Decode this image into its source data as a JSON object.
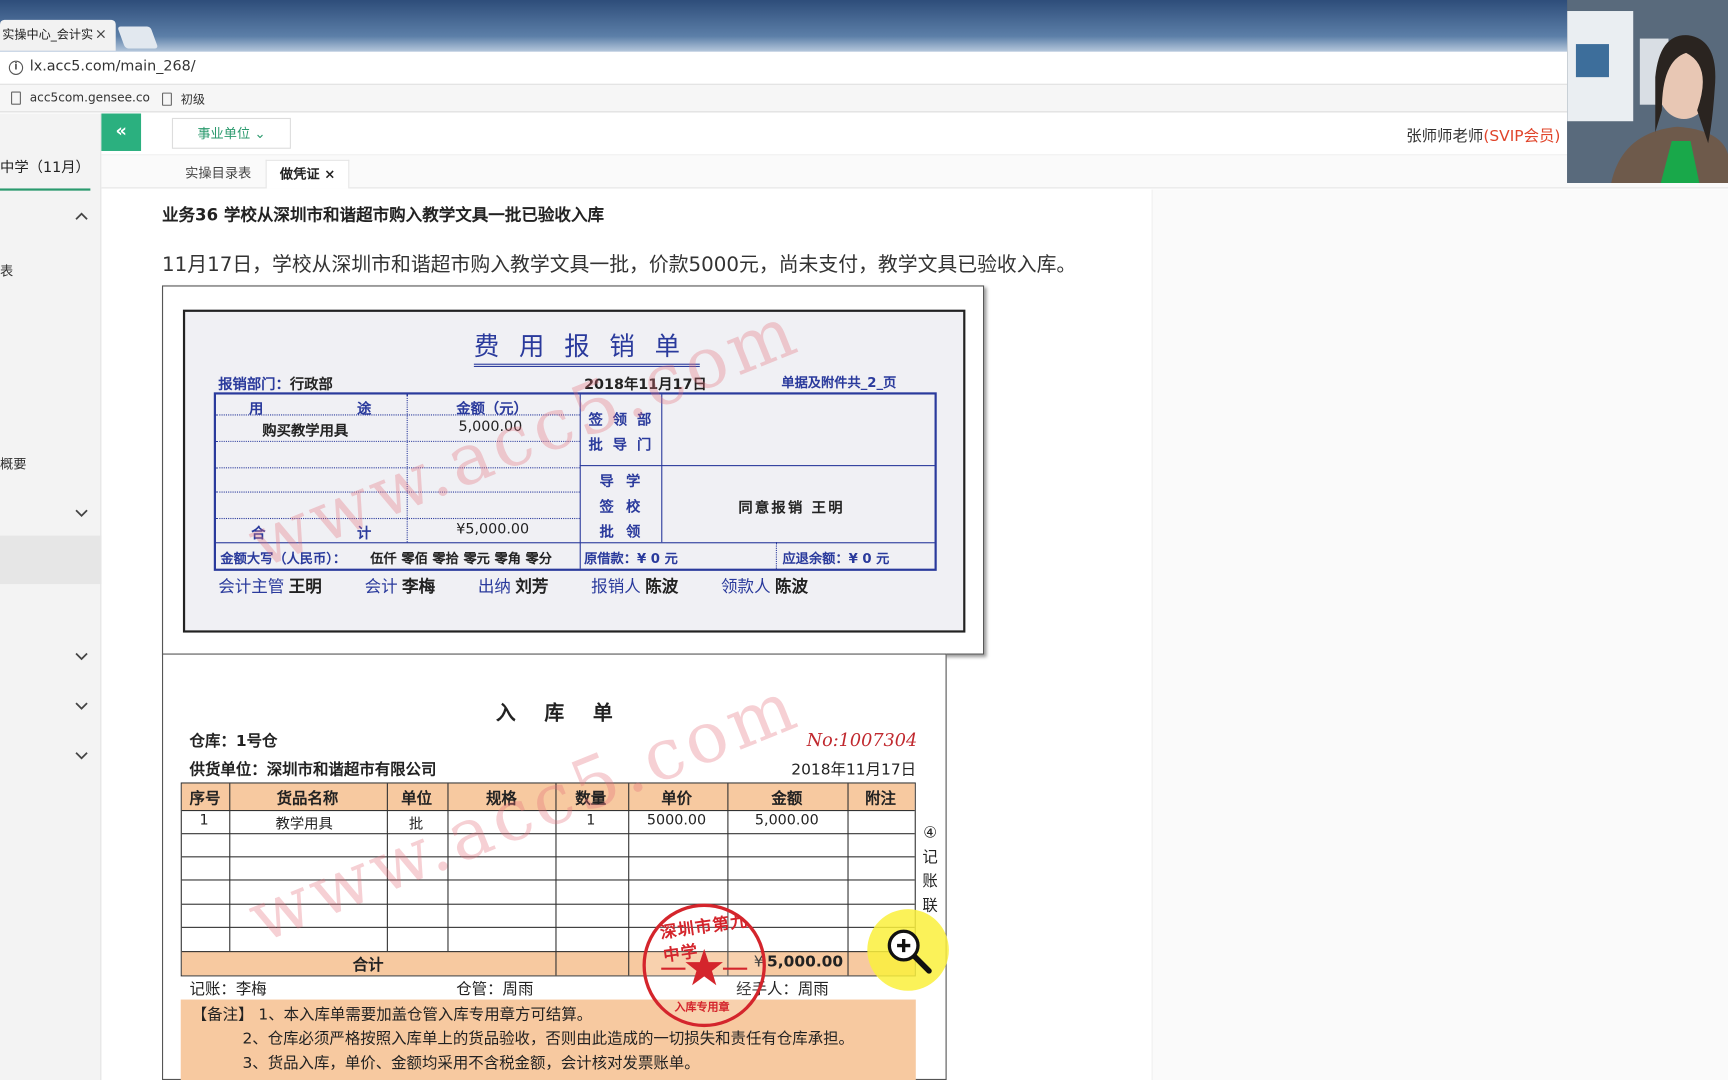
{
  "browser": {
    "tab_title": "实操中心_会计实",
    "url": "lx.acc5.com/main_268/",
    "bookmarks": [
      "acc5com.gensee.co",
      "初级"
    ]
  },
  "app": {
    "unit_select": "事业单位",
    "user_name": "张师师老师",
    "vip": "(SVIP会员)",
    "collapse_icon": "«",
    "sidebar": {
      "title": "中学（11月）",
      "items": [
        "表",
        "概要"
      ]
    },
    "subtabs": [
      "实操目录表",
      "做凭证"
    ],
    "close": "×"
  },
  "task": {
    "title": "业务36 学校从深圳市和谐超市购入教学文具一批已验收入库",
    "desc": "11月17日，学校从深圳市和谐超市购入教学文具一批，价款5000元，尚未支付，教学文具已验收入库。"
  },
  "reimburse": {
    "title": "费用报销单",
    "dept_label": "报销部门：",
    "dept": "行政部",
    "date": "2018年11月17日",
    "attach": "单据及附件共_2_页",
    "col_purpose": [
      "用",
      "途"
    ],
    "col_amount": "金额（元）",
    "item": "购买教学用具",
    "item_amount": "5,000.00",
    "total_label": [
      "合",
      "计"
    ],
    "total": "¥5,000.00",
    "dept_sign": [
      "签",
      "领",
      "部",
      "批",
      "导",
      "门"
    ],
    "school_sign": [
      "导",
      "学",
      "签",
      "校",
      "批",
      "领"
    ],
    "approval": "同意报销 王明",
    "daxie_label": "金额大写（人民币）：",
    "daxie": "伍仟 零佰 零拾 零元 零角 零分",
    "borrow": "原借款：¥  0   元",
    "refund": "应退余额：¥  0   元",
    "signers": [
      {
        "role": "会计主管",
        "name": "王明"
      },
      {
        "role": "会计",
        "name": "李梅"
      },
      {
        "role": "出纳",
        "name": "刘芳"
      },
      {
        "role": "报销人",
        "name": "陈波"
      },
      {
        "role": "领款人",
        "name": "陈波"
      }
    ]
  },
  "receipt": {
    "title": "入库单",
    "warehouse": "仓库：1号仓",
    "no": "No:1007304",
    "supplier": "供货单位：深圳市和谐超市有限公司",
    "date": "2018年11月17日",
    "headers": [
      "序号",
      "货品名称",
      "单位",
      "规格",
      "数量",
      "单价",
      "金额",
      "附注"
    ],
    "row": [
      "1",
      "教学用具",
      "批",
      "",
      "1",
      "5000.00",
      "5,000.00",
      ""
    ],
    "total_label": "合计",
    "total": "5,000.00",
    "total_prefix": "¥",
    "side_copy": [
      "④",
      "记",
      "账",
      "联"
    ],
    "clerk": "记账：李梅",
    "keeper": "仓管：周雨",
    "handler": "经手人：周雨",
    "remarks": [
      "【备注】 1、本入库单需要加盖仓管入库专用章方可结算。",
      "2、仓库必须严格按照入库单上的货品验收，否则由此造成的一切损失和责任有仓库承担。",
      "3、货品入库，单价、金额均采用不含税金额，会计核对发票账单。"
    ],
    "stamp_top": "深圳市第九中学",
    "stamp_bottom": "入库专用章"
  },
  "watermark": "www.acc5.com"
}
